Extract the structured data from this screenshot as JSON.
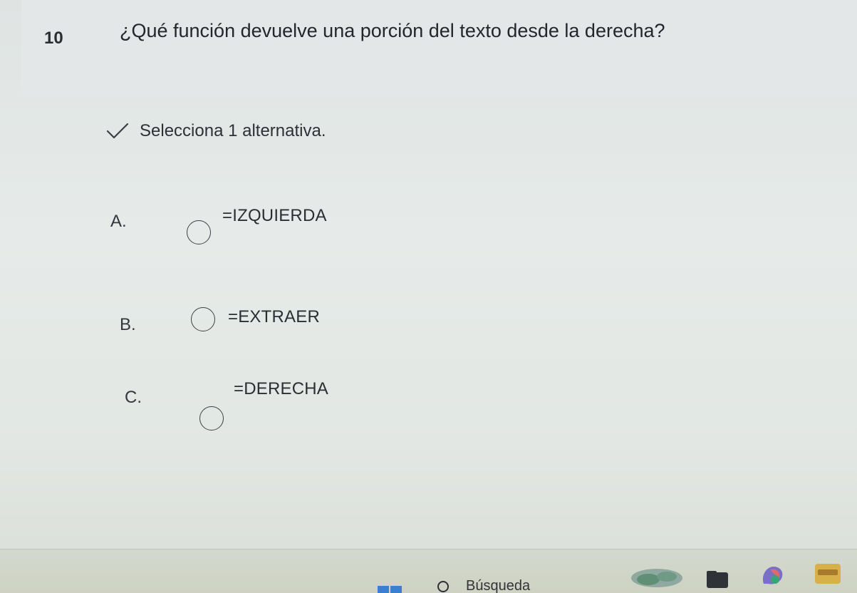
{
  "question": {
    "number": "10",
    "text": "¿Qué función devuelve una porción del texto desde la derecha?"
  },
  "instruction": {
    "text": "Selecciona 1 alternativa.",
    "icon": "checkmark-icon"
  },
  "options": [
    {
      "letter": "A.",
      "value": "=IZQUIERDA",
      "selected": false
    },
    {
      "letter": "B.",
      "value": "=EXTRAER",
      "selected": false
    },
    {
      "letter": "C.",
      "value": "=DERECHA",
      "selected": false
    }
  ],
  "taskbar": {
    "search_label": "Búsqueda",
    "icons": [
      "windows-start-icon",
      "search-icon",
      "weather-widget-icon",
      "file-explorer-icon",
      "copilot-icon",
      "app-icon"
    ]
  },
  "colors": {
    "background": "#e4e9e7",
    "text": "#2b2f35",
    "taskbar": "#d0d5c8"
  }
}
